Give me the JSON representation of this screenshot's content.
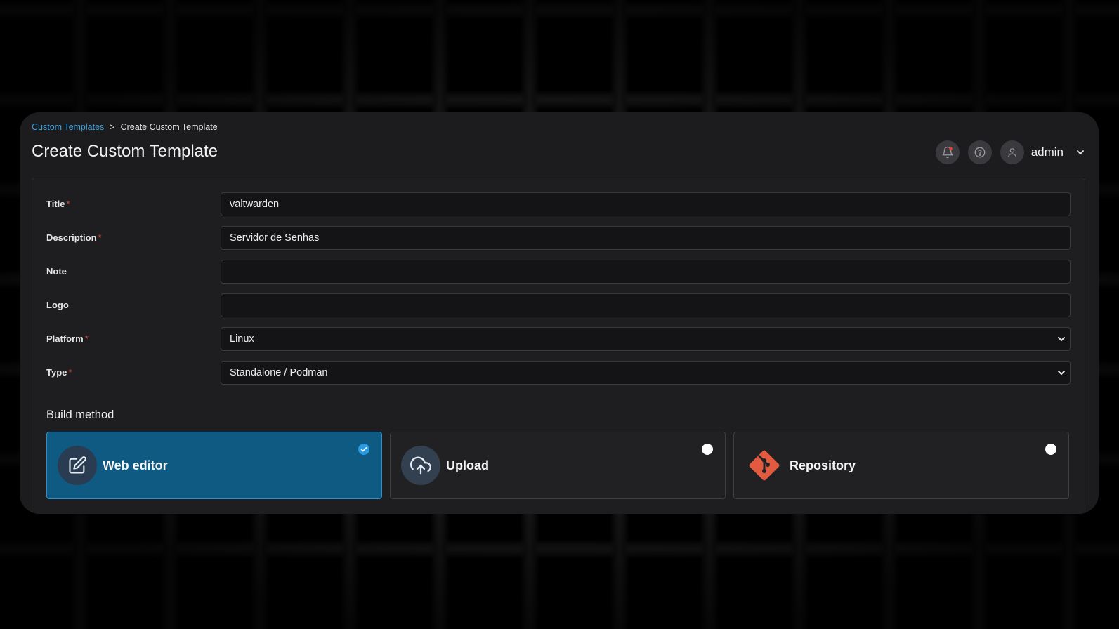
{
  "breadcrumb": {
    "parent": "Custom Templates",
    "separator": ">",
    "current": "Create Custom Template"
  },
  "page": {
    "title": "Create Custom Template"
  },
  "topbar": {
    "notifications_icon": "bell-icon",
    "help_icon": "help-icon",
    "user_name": "admin"
  },
  "form": {
    "title_label": "Title",
    "title_value": "valtwarden",
    "description_label": "Description",
    "description_value": "Servidor de Senhas",
    "note_label": "Note",
    "note_value": "",
    "logo_label": "Logo",
    "logo_value": "",
    "platform_label": "Platform",
    "platform_value": "Linux",
    "type_label": "Type",
    "type_value": "Standalone / Podman",
    "required_marker": "*"
  },
  "build_method": {
    "title": "Build method",
    "options": [
      {
        "label": "Web editor",
        "icon": "edit-icon",
        "selected": true
      },
      {
        "label": "Upload",
        "icon": "upload-cloud-icon",
        "selected": false
      },
      {
        "label": "Repository",
        "icon": "git-icon",
        "selected": false
      }
    ]
  },
  "colors": {
    "accent": "#3ea3e0",
    "selected_card": "#0e5a82",
    "required": "#d9463b",
    "git": "#e25a3f"
  }
}
